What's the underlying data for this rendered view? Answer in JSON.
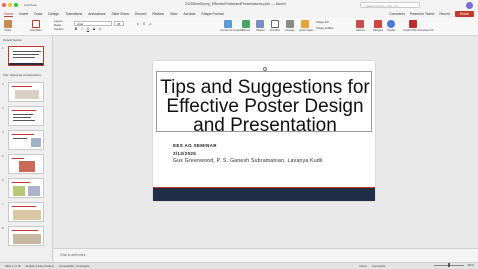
{
  "window": {
    "title": "2025SeedSymp_EffectivePosterandPresentations.pptx — Saved",
    "autosave": "AutoSave",
    "search_placeholder": "Search (Cmd + Ctrl + U)"
  },
  "tabs": [
    "Home",
    "Insert",
    "Draw",
    "Design",
    "Transitions",
    "Animations",
    "Slide Show",
    "Record",
    "Review",
    "View",
    "Acrobat",
    "Shape Format"
  ],
  "active_tab": "Home",
  "header_actions": {
    "comments": "Comments",
    "present": "Present in Teams",
    "record": "Record",
    "share": "Share"
  },
  "ribbon": {
    "paste": "Paste",
    "new_slide": "New Slide",
    "layout": "Layout",
    "reset": "Reset",
    "section": "Section",
    "font": "Arial",
    "font_size": "36",
    "convert_smartart": "Convert to SmartArt",
    "picture": "Picture",
    "shapes": "Shapes",
    "text_box": "Text Box",
    "arrange": "Arrange",
    "quick_styles": "Quick Styles",
    "shape_fill": "Shape Fill",
    "shape_outline": "Shape Outline",
    "add_ins": "Add-ins",
    "designer": "Designer",
    "copilot": "Copilot",
    "create_pdf": "Create PDF and share link"
  },
  "thumbnails": {
    "section_default": "Default Section",
    "section_two": "Title: High-level considerations...",
    "slides": [
      1,
      2,
      3,
      4,
      5,
      6,
      7,
      8
    ]
  },
  "slide": {
    "title": "Tips and Suggestions for Effective Poster Design and Presentation",
    "seminar": "EES AG SEMINAR",
    "date": "3/13/2025",
    "authors": "Gus Greenwood, P. S. Ganesh Subramanian, Lavanya Kudli"
  },
  "notes_placeholder": "Click to add notes",
  "status": {
    "slide_count": "Slide 1 of 18",
    "language": "English (United States)",
    "accessibility": "Accessibility: Investigate",
    "notes": "Notes",
    "comments": "Comments",
    "zoom": "111%"
  },
  "colors": {
    "accent": "#c0392b",
    "navy": "#1f2d47"
  }
}
